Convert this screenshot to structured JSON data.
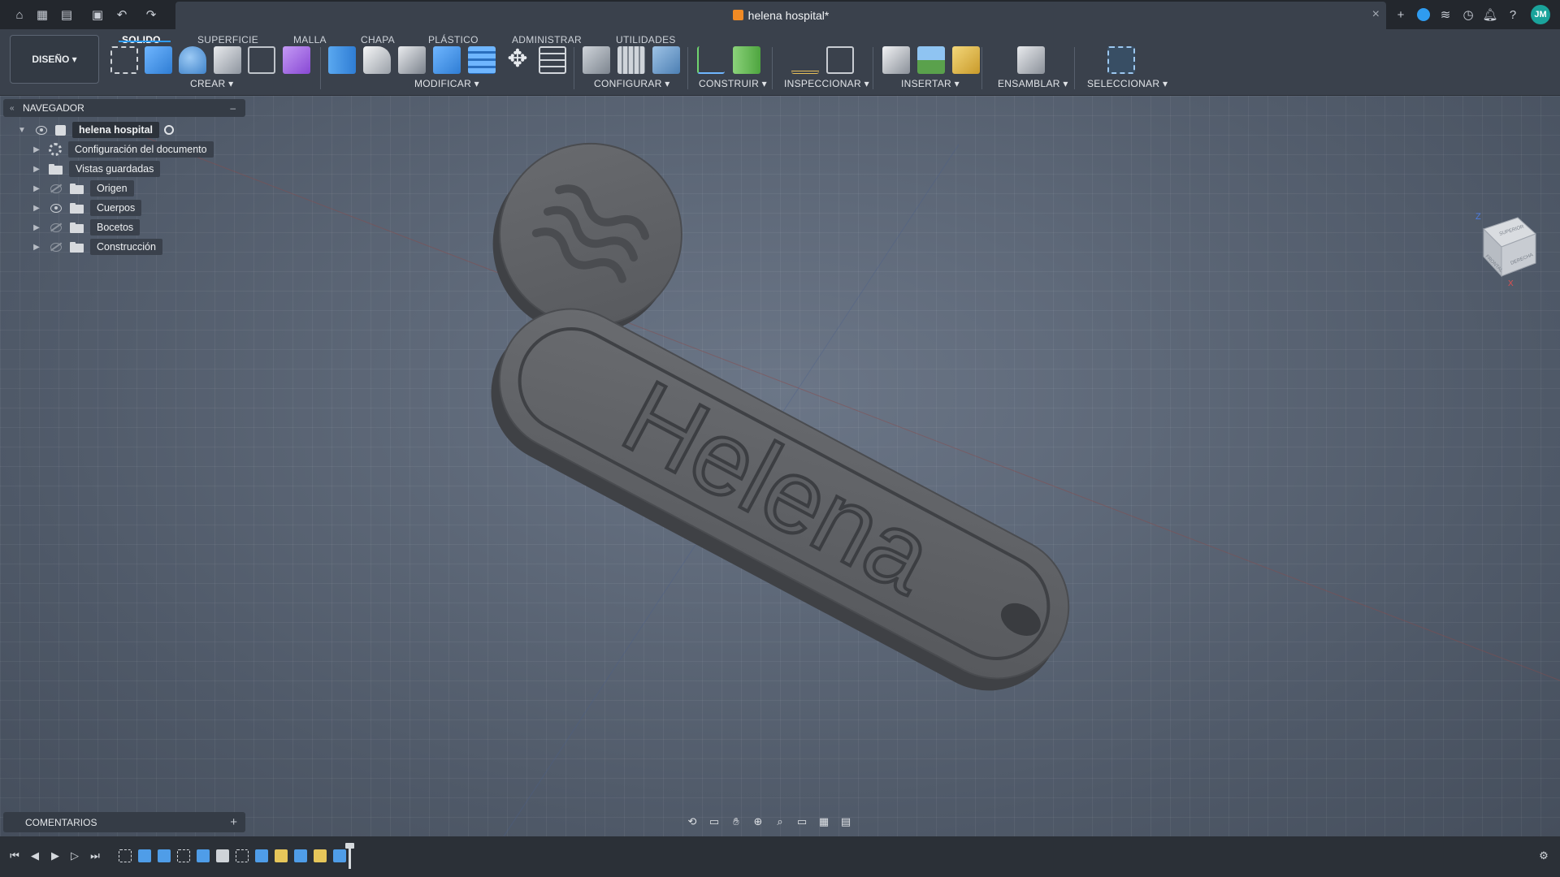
{
  "document": {
    "title": "helena hospital*"
  },
  "user": {
    "initials": "JM"
  },
  "workspace": {
    "label": "DISEÑO ▾"
  },
  "tabs": [
    {
      "label": "SOLIDO",
      "active": true
    },
    {
      "label": "SUPERFICIE"
    },
    {
      "label": "MALLA"
    },
    {
      "label": "CHAPA"
    },
    {
      "label": "PLÁSTICO"
    },
    {
      "label": "ADMINISTRAR"
    },
    {
      "label": "UTILIDADES"
    }
  ],
  "groups": [
    {
      "label": "CREAR ▾"
    },
    {
      "label": "MODIFICAR ▾"
    },
    {
      "label": "CONFIGURAR ▾"
    },
    {
      "label": "CONSTRUIR ▾"
    },
    {
      "label": "INSPECCIONAR ▾"
    },
    {
      "label": "INSERTAR ▾"
    },
    {
      "label": "ENSAMBLAR ▾"
    },
    {
      "label": "SELECCIONAR ▾"
    }
  ],
  "browser": {
    "title": "NAVEGADOR",
    "root": "helena hospital",
    "items": [
      {
        "label": "Configuración del documento",
        "icon": "gear-icon"
      },
      {
        "label": "Vistas guardadas",
        "icon": "folder-icon"
      },
      {
        "label": "Origen",
        "icon": "folder-icon",
        "visible": false
      },
      {
        "label": "Cuerpos",
        "icon": "folder-icon",
        "visible": true
      },
      {
        "label": "Bocetos",
        "icon": "folder-icon",
        "visible": false
      },
      {
        "label": "Construcción",
        "icon": "folder-icon",
        "visible": false
      }
    ]
  },
  "comments": {
    "label": "COMENTARIOS"
  },
  "model": {
    "text": "Helena"
  },
  "viewcube": {
    "axis_z": "Z",
    "axis_x": "X",
    "face_top": "SUPERIOR",
    "face_front": "FRONTAL",
    "face_right": "DERECHA"
  },
  "colors": {
    "accent": "#2f9cf0",
    "model": "#5d5f63",
    "background": "#576172",
    "brand_orange": "#f08a24"
  }
}
